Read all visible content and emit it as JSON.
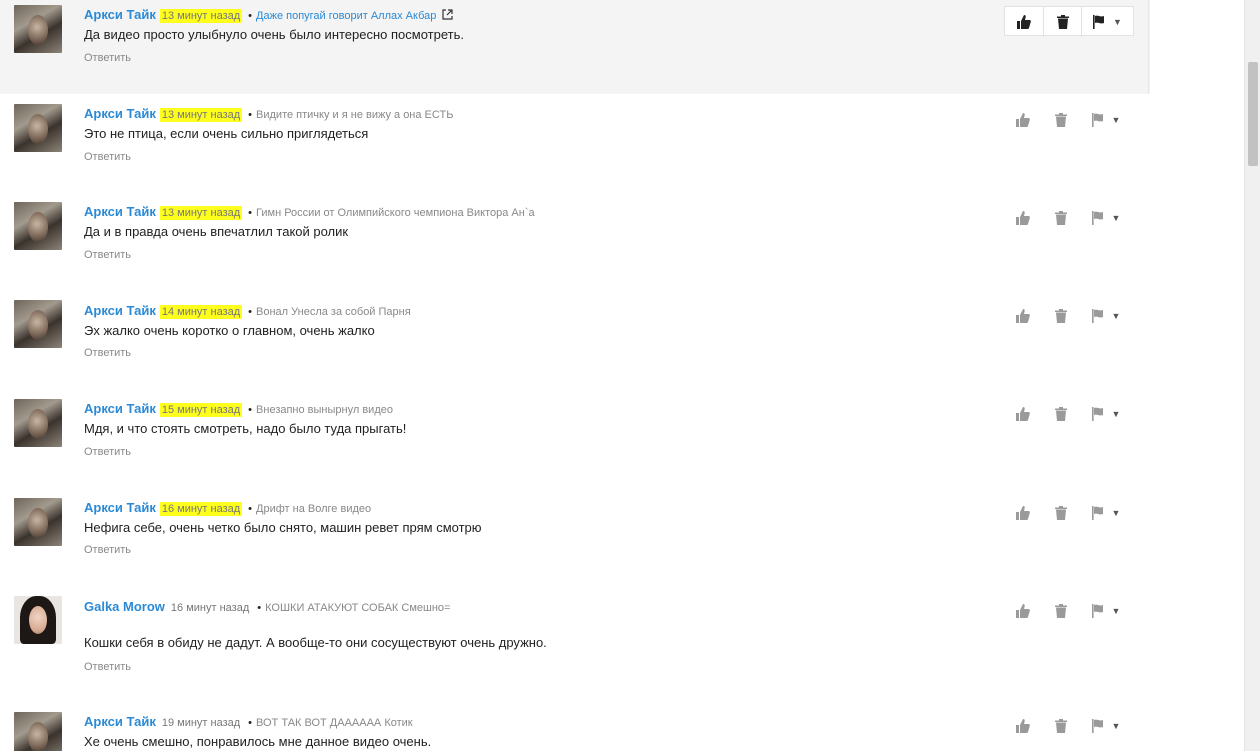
{
  "comments": [
    {
      "author": "Аркси Тайк",
      "time": "13 минут назад",
      "video": "Даже попугай говорит Аллах Акбар",
      "text": "Да видео просто улыбнуло очень было интересно посмотреть.",
      "reply": "Ответить"
    },
    {
      "author": "Аркси Тайк",
      "time": "13 минут назад",
      "video": "Видите птичку и я не вижу а она ЕСТЬ",
      "text": "Это не птица, если очень сильно приглядеться",
      "reply": "Ответить"
    },
    {
      "author": "Аркси Тайк",
      "time": "13 минут назад",
      "video": "Гимн России от Олимпийского чемпиона Виктора Ан`а",
      "text": "Да и в правда очень впечатлил такой ролик",
      "reply": "Ответить"
    },
    {
      "author": "Аркси Тайк",
      "time": "14 минут назад",
      "video": "Вонал Унесла за собой Парня",
      "text": "Эх жалко очень коротко о главном, очень жалко",
      "reply": "Ответить"
    },
    {
      "author": "Аркси Тайк",
      "time": "15 минут назад",
      "video": "Внезапно вынырнул видео",
      "text": "Мдя, и что стоять смотреть, надо было туда прыгать!",
      "reply": "Ответить"
    },
    {
      "author": "Аркси Тайк",
      "time": "16 минут назад",
      "video": "Дрифт на Волге видео",
      "text": "Нефига себе, очень четко было снято, машин ревет прям смотрю",
      "reply": "Ответить"
    },
    {
      "author": "Galka Morow",
      "time": "16 минут назад",
      "video": "КОШКИ АТАКУЮТ СОБАК Смешно=",
      "text": "Кошки себя в обиду не дадут. А вообще-то они сосуществуют очень дружно.",
      "reply": "Ответить"
    },
    {
      "author": "Аркси Тайк",
      "time": "19 минут назад",
      "video": "ВОТ ТАК ВОТ ДАААААА Котик",
      "text": "Хе очень смешно, понравилось мне данное видео очень.",
      "reply": ""
    }
  ],
  "bullet": "•",
  "icons": {
    "like": "thumbs-up-icon",
    "delete": "trash-icon",
    "flag": "flag-icon",
    "menu": "chevron-down-icon",
    "external": "external-link-icon"
  },
  "colors": {
    "author": "#2b8ad6",
    "highlight": "#ffff1e",
    "hover_bg": "#f4f4f4",
    "icon_active": "#222222",
    "icon_muted": "#9a9a9a"
  },
  "scrollbar": {
    "position_fraction": 0.08
  }
}
